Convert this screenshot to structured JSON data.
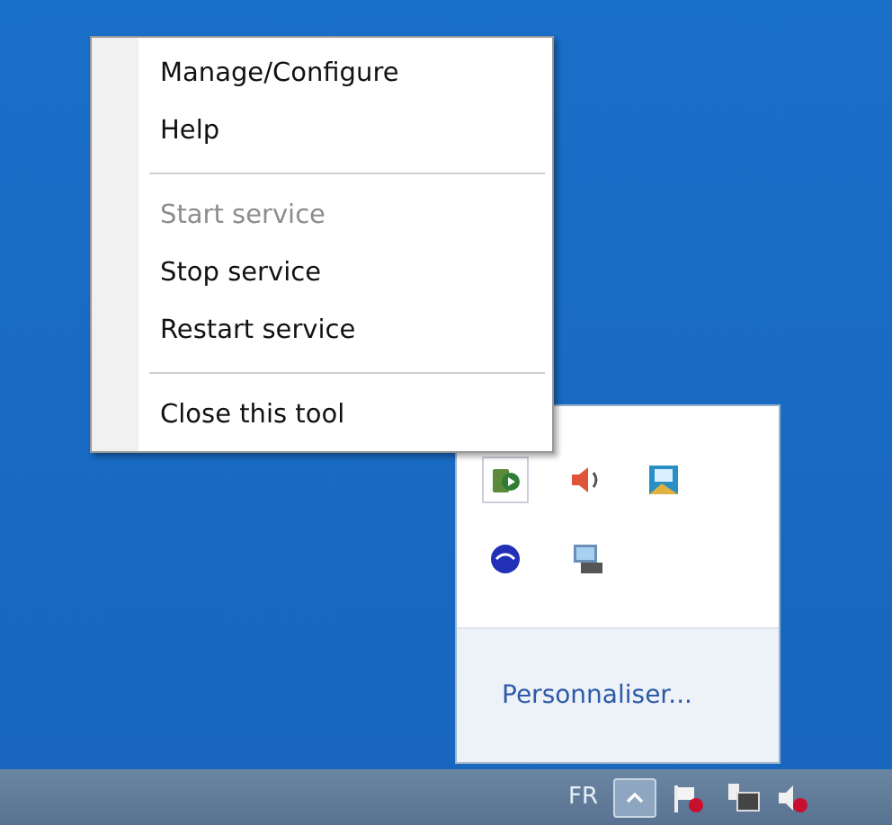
{
  "context_menu": {
    "groups": [
      [
        {
          "label": "Manage/Configure",
          "disabled": false
        },
        {
          "label": "Help",
          "disabled": false
        }
      ],
      [
        {
          "label": "Start service",
          "disabled": true
        },
        {
          "label": "Stop service",
          "disabled": false
        },
        {
          "label": "Restart service",
          "disabled": false
        }
      ],
      [
        {
          "label": "Close this tool",
          "disabled": false
        }
      ]
    ]
  },
  "tray_popup": {
    "customize_link": "Personnaliser..."
  },
  "taskbar": {
    "language": "FR"
  }
}
